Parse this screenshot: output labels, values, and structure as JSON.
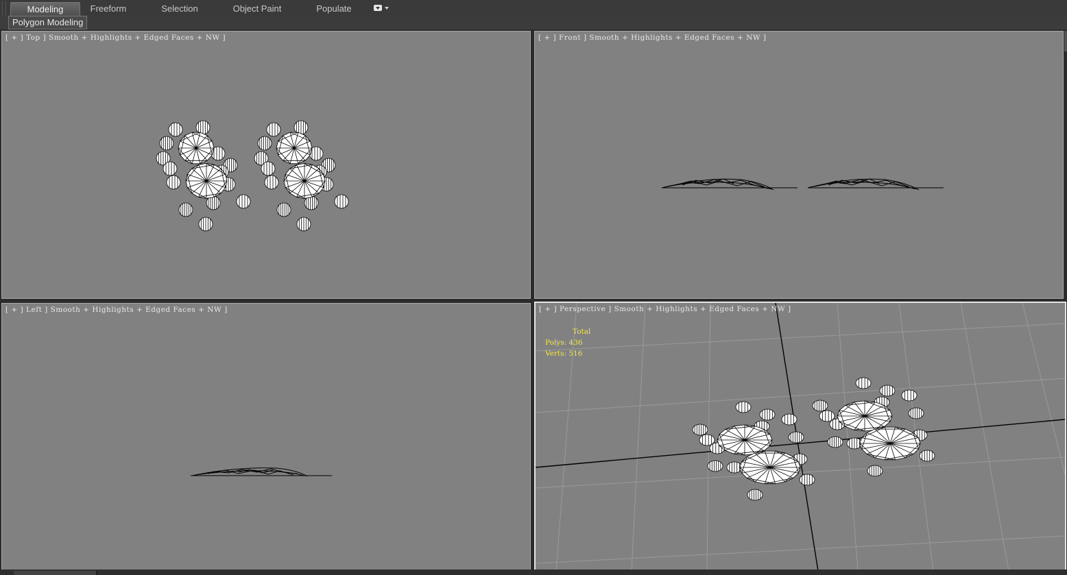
{
  "ribbon": {
    "tabs": [
      {
        "label": "Modeling",
        "active": true
      },
      {
        "label": "Freeform",
        "active": false
      },
      {
        "label": "Selection",
        "active": false
      },
      {
        "label": "Object Paint",
        "active": false
      },
      {
        "label": "Populate",
        "active": false
      }
    ],
    "menu_icon": "dropdown-box-icon",
    "subpanel_label": "Polygon Modeling"
  },
  "viewports": {
    "top": {
      "label": "[ + ] Top ] Smooth + Highlights + Edged Faces + NW ]"
    },
    "front": {
      "label": "[ + ] Front ] Smooth + Highlights + Edged Faces + NW ]"
    },
    "left": {
      "label": "[ + ] Left ] Smooth + Highlights + Edged Faces + NW ]"
    },
    "perspective": {
      "label": "[ + ] Perspective ] Smooth + Highlights + Edged Faces + NW ]"
    }
  },
  "stats": {
    "title": "Total",
    "polys_label": "Polys:",
    "polys_value": "436",
    "verts_label": "Verts:",
    "verts_value": "516",
    "color": "#f5e64a"
  },
  "colors": {
    "viewport_bg": "#818181",
    "active_border": "#e5e5e5",
    "ui_dark": "#3a3a3a"
  }
}
